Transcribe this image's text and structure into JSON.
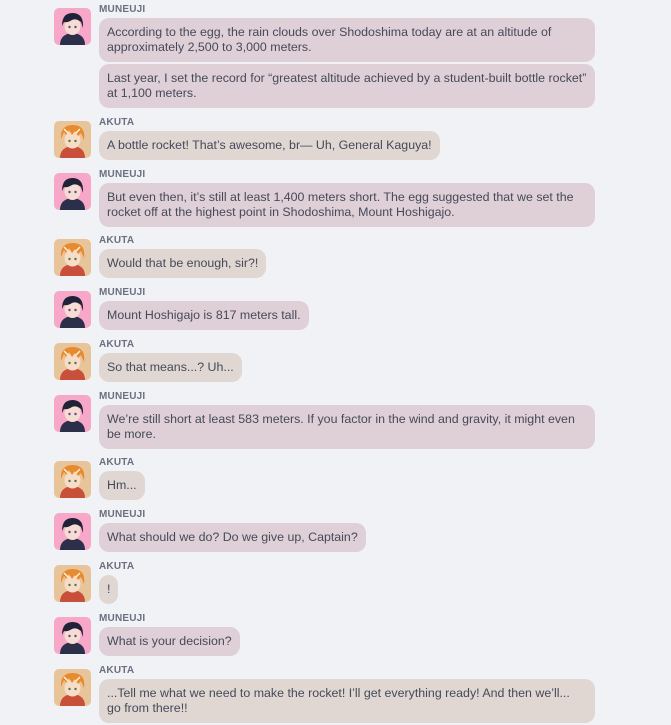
{
  "characters": {
    "muneuji": {
      "name": "MUNEUJI",
      "bubble_color": "#dfcfd6"
    },
    "akuta": {
      "name": "AKUTA",
      "bubble_color": "#e0d6d2"
    }
  },
  "messages": [
    {
      "speaker": "MUNEUJI",
      "lines": [
        "According to the egg, the rain clouds over Shodoshima today are at an altitude of approximately 2,500 to 3,000 meters.",
        "Last year, I set the record for “greatest altitude achieved by a student-built bottle rocket” at 1,100 meters."
      ]
    },
    {
      "speaker": "AKUTA",
      "lines": [
        "A bottle rocket! That’s awesome, br— Uh, General Kaguya!"
      ]
    },
    {
      "speaker": "MUNEUJI",
      "lines": [
        "But even then, it’s still at least 1,400 meters short. The egg suggested that we set the rocket off at the highest point in Shodoshima, Mount Hoshigajo."
      ]
    },
    {
      "speaker": "AKUTA",
      "lines": [
        "Would that be enough, sir?!"
      ]
    },
    {
      "speaker": "MUNEUJI",
      "lines": [
        "Mount Hoshigajo is 817 meters tall."
      ]
    },
    {
      "speaker": "AKUTA",
      "lines": [
        "So that means...? Uh..."
      ]
    },
    {
      "speaker": "MUNEUJI",
      "lines": [
        "We’re still short at least 583 meters. If you factor in the wind and gravity, it might even be more."
      ]
    },
    {
      "speaker": "AKUTA",
      "lines": [
        "Hm..."
      ]
    },
    {
      "speaker": "MUNEUJI",
      "lines": [
        "What should we do? Do we give up, Captain?"
      ]
    },
    {
      "speaker": "AKUTA",
      "lines": [
        "!"
      ]
    },
    {
      "speaker": "MUNEUJI",
      "lines": [
        "What is your decision?"
      ]
    },
    {
      "speaker": "AKUTA",
      "lines": [
        "...Tell me what we need to make the rocket! I’ll get everything ready! And then we’ll... go from there!!"
      ]
    }
  ]
}
